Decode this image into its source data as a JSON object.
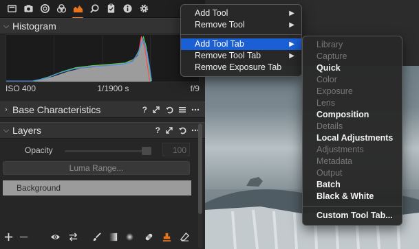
{
  "tab_icons": [
    "library-icon",
    "capture-icon",
    "lens-icon",
    "color-icon",
    "adjustments-icon",
    "details-icon",
    "metadata-icon",
    "info-icon",
    "settings-icon"
  ],
  "accent_color": "#e8741e",
  "histogram": {
    "title": "Histogram",
    "iso": "ISO 400",
    "shutter": "1/1900 s",
    "aperture": "f/9"
  },
  "base_characteristics": {
    "title": "Base Characteristics",
    "help": "?"
  },
  "layers": {
    "title": "Layers",
    "help": "?",
    "opacity_label": "Opacity",
    "opacity_value": "100",
    "luma_range_label": "Luma Range...",
    "background_label": "Background"
  },
  "main_menu": {
    "items": [
      {
        "label": "Add Tool"
      },
      {
        "label": "Remove Tool"
      },
      {
        "label": "Add Tool Tab"
      },
      {
        "label": "Remove Tool Tab"
      },
      {
        "label": "Remove Exposure Tab"
      }
    ]
  },
  "submenu": {
    "items": [
      {
        "label": "Library",
        "enabled": false
      },
      {
        "label": "Capture",
        "enabled": false
      },
      {
        "label": "Quick",
        "enabled": true
      },
      {
        "label": "Color",
        "enabled": false
      },
      {
        "label": "Exposure",
        "enabled": false
      },
      {
        "label": "Lens",
        "enabled": false
      },
      {
        "label": "Composition",
        "enabled": true
      },
      {
        "label": "Details",
        "enabled": false
      },
      {
        "label": "Local Adjustments",
        "enabled": true
      },
      {
        "label": "Adjustments",
        "enabled": false
      },
      {
        "label": "Metadata",
        "enabled": false
      },
      {
        "label": "Output",
        "enabled": false
      },
      {
        "label": "Batch",
        "enabled": true
      },
      {
        "label": "Black & White",
        "enabled": true
      },
      {
        "label": "Custom Tool Tab...",
        "enabled": true
      }
    ]
  }
}
